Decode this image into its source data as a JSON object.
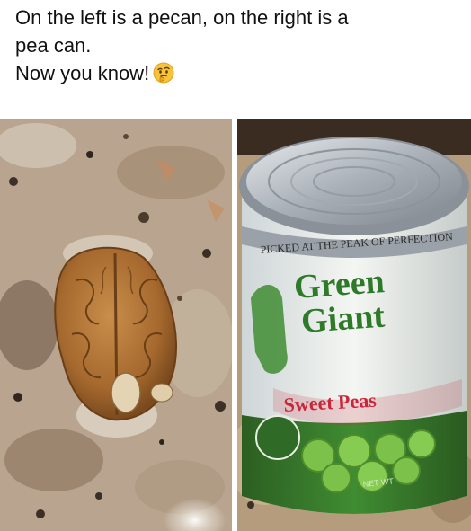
{
  "caption": {
    "line1": "On the left is a pecan, on the right is a",
    "line2": "pea can.",
    "line3": "Now you know!",
    "emoji_icon": "thinking-face-emoji"
  },
  "photos": {
    "left": {
      "subject": "pecan-half-on-granite"
    },
    "right": {
      "subject": "green-giant-sweet-peas-can",
      "can_tagline": "PICKED AT THE PEAK OF PERFECTION",
      "brand_line1": "Green",
      "brand_line2": "Giant",
      "product": "Sweet Peas",
      "net_wt": "NET WT"
    }
  },
  "colors": {
    "granite_base": "#b8a48e",
    "pecan": "#a8733a",
    "can_green": "#2f7a2a",
    "can_white": "#eef0ec",
    "sweet_peas_red": "#c8263a"
  }
}
